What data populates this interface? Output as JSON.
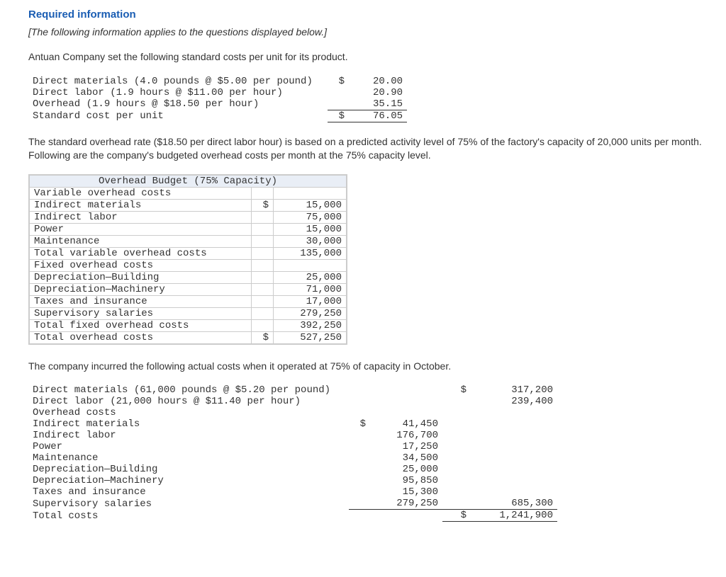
{
  "heading": "Required information",
  "intro": "[The following information applies to the questions displayed below.]",
  "para1": "Antuan Company set the following standard costs per unit for its product.",
  "std_costs": {
    "rows": [
      {
        "label": "Direct materials (4.0 pounds @ $5.00 per pound)",
        "dollar": "$",
        "value": "20.00",
        "bottom": false
      },
      {
        "label": "Direct labor (1.9 hours @ $11.00 per hour)",
        "dollar": "",
        "value": "20.90",
        "bottom": false
      },
      {
        "label": "Overhead (1.9 hours @ $18.50 per hour)",
        "dollar": "",
        "value": "35.15",
        "bottom": true
      },
      {
        "label": "Standard cost per unit",
        "dollar": "$",
        "value": "76.05",
        "bottom": true
      }
    ]
  },
  "para2": "The standard overhead rate ($18.50 per direct labor hour) is based on a predicted activity level of 75% of the factory's capacity of 20,000 units per month. Following are the company's budgeted overhead costs per month at the 75% capacity level.",
  "budget": {
    "title": "Overhead Budget (75% Capacity)",
    "rows": [
      {
        "label": "Variable overhead costs",
        "indent": 0,
        "dollar": "",
        "value": "",
        "bottom": false
      },
      {
        "label": "Indirect materials",
        "indent": 1,
        "dollar": "$",
        "value": "15,000",
        "bottom": false
      },
      {
        "label": "Indirect labor",
        "indent": 1,
        "dollar": "",
        "value": "75,000",
        "bottom": false
      },
      {
        "label": "Power",
        "indent": 1,
        "dollar": "",
        "value": "15,000",
        "bottom": false
      },
      {
        "label": "Maintenance",
        "indent": 1,
        "dollar": "",
        "value": "30,000",
        "bottom": true
      },
      {
        "label": "Total variable overhead costs",
        "indent": 1,
        "dollar": "",
        "value": "135,000",
        "bottom": false
      },
      {
        "label": "Fixed overhead costs",
        "indent": 0,
        "dollar": "",
        "value": "",
        "bottom": false
      },
      {
        "label": "Depreciation—Building",
        "indent": 1,
        "dollar": "",
        "value": "25,000",
        "bottom": false
      },
      {
        "label": "Depreciation—Machinery",
        "indent": 1,
        "dollar": "",
        "value": "71,000",
        "bottom": false
      },
      {
        "label": "Taxes and insurance",
        "indent": 1,
        "dollar": "",
        "value": "17,000",
        "bottom": false
      },
      {
        "label": "Supervisory salaries",
        "indent": 1,
        "dollar": "",
        "value": "279,250",
        "bottom": true
      },
      {
        "label": "Total fixed overhead costs",
        "indent": 1,
        "dollar": "",
        "value": "392,250",
        "bottom": true
      },
      {
        "label": "Total overhead costs",
        "indent": 0,
        "dollar": "$",
        "value": "527,250",
        "bottom": true
      }
    ]
  },
  "para3": "The company incurred the following actual costs when it operated at 75% of capacity in October.",
  "actual": {
    "rows": [
      {
        "label": "Direct materials (61,000 pounds @ $5.20 per pound)",
        "indent": 0,
        "d1": "",
        "v1": "",
        "d2": "$",
        "v2": "317,200",
        "b1": false,
        "b2": false
      },
      {
        "label": "Direct labor (21,000 hours @ $11.40 per hour)",
        "indent": 0,
        "d1": "",
        "v1": "",
        "d2": "",
        "v2": "239,400",
        "b1": false,
        "b2": false
      },
      {
        "label": "Overhead costs",
        "indent": 0,
        "d1": "",
        "v1": "",
        "d2": "",
        "v2": "",
        "b1": false,
        "b2": false
      },
      {
        "label": "Indirect materials",
        "indent": 1,
        "d1": "$",
        "v1": "41,450",
        "d2": "",
        "v2": "",
        "b1": false,
        "b2": false
      },
      {
        "label": "Indirect labor",
        "indent": 1,
        "d1": "",
        "v1": "176,700",
        "d2": "",
        "v2": "",
        "b1": false,
        "b2": false
      },
      {
        "label": "Power",
        "indent": 1,
        "d1": "",
        "v1": "17,250",
        "d2": "",
        "v2": "",
        "b1": false,
        "b2": false
      },
      {
        "label": "Maintenance",
        "indent": 1,
        "d1": "",
        "v1": "34,500",
        "d2": "",
        "v2": "",
        "b1": false,
        "b2": false
      },
      {
        "label": "Depreciation—Building",
        "indent": 1,
        "d1": "",
        "v1": "25,000",
        "d2": "",
        "v2": "",
        "b1": false,
        "b2": false
      },
      {
        "label": "Depreciation—Machinery",
        "indent": 1,
        "d1": "",
        "v1": "95,850",
        "d2": "",
        "v2": "",
        "b1": false,
        "b2": false
      },
      {
        "label": "Taxes and insurance",
        "indent": 1,
        "d1": "",
        "v1": "15,300",
        "d2": "",
        "v2": "",
        "b1": false,
        "b2": false
      },
      {
        "label": "Supervisory salaries",
        "indent": 1,
        "d1": "",
        "v1": "279,250",
        "d2": "",
        "v2": "685,300",
        "b1": true,
        "b2": true
      },
      {
        "label": "Total costs",
        "indent": 0,
        "d1": "",
        "v1": "",
        "d2": "$",
        "v2": "1,241,900",
        "b1": false,
        "b2": true
      }
    ]
  }
}
